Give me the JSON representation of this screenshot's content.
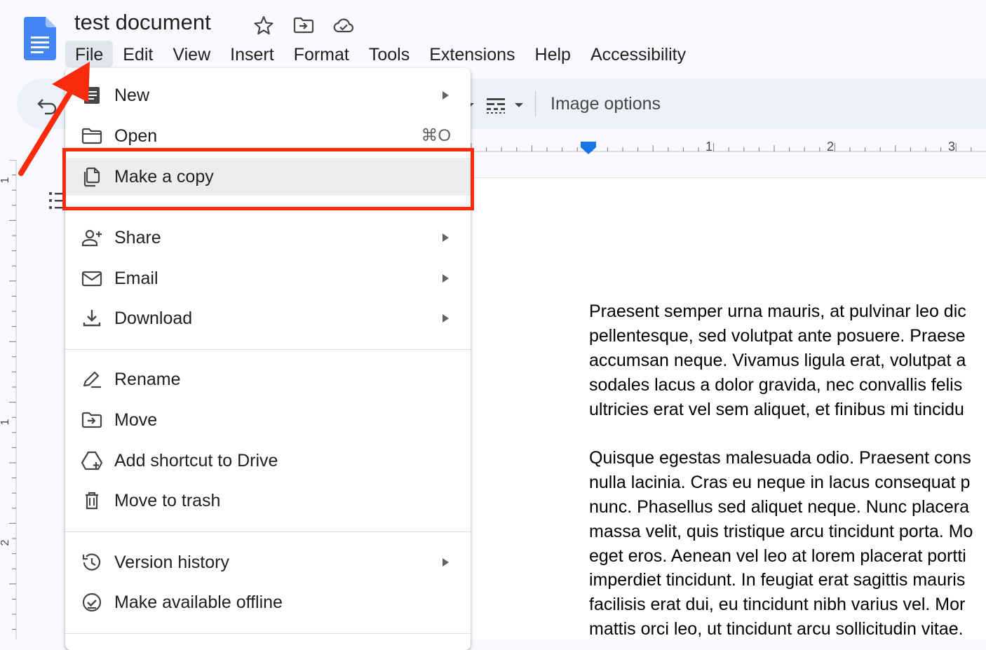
{
  "header": {
    "title": "test document",
    "icons": [
      "docs-logo-icon",
      "star-icon",
      "move-folder-icon",
      "cloud-saved-icon"
    ]
  },
  "menubar": {
    "items": [
      {
        "label": "File"
      },
      {
        "label": "Edit"
      },
      {
        "label": "View"
      },
      {
        "label": "Insert"
      },
      {
        "label": "Format"
      },
      {
        "label": "Tools"
      },
      {
        "label": "Extensions"
      },
      {
        "label": "Help"
      },
      {
        "label": "Accessibility"
      }
    ],
    "active": "File"
  },
  "toolbar": {
    "image_options_label": "Image options"
  },
  "ruler": {
    "h_labels": [
      "1",
      "2",
      "3"
    ],
    "v_labels": [
      "1",
      "1",
      "2"
    ]
  },
  "file_menu": {
    "items": {
      "new": {
        "label": "New",
        "icon": "new-doc-icon",
        "submenu": true
      },
      "open": {
        "label": "Open",
        "icon": "folder-icon",
        "shortcut": "⌘O"
      },
      "make_copy": {
        "label": "Make a copy",
        "icon": "copy-icon",
        "highlighted": true
      },
      "share": {
        "label": "Share",
        "icon": "share-person-icon",
        "submenu": true
      },
      "email": {
        "label": "Email",
        "icon": "mail-icon",
        "submenu": true
      },
      "download": {
        "label": "Download",
        "icon": "download-icon",
        "submenu": true
      },
      "rename": {
        "label": "Rename",
        "icon": "rename-icon"
      },
      "move": {
        "label": "Move",
        "icon": "move-folder-icon"
      },
      "add_shortcut": {
        "label": "Add shortcut to Drive",
        "icon": "drive-shortcut-icon"
      },
      "trash": {
        "label": "Move to trash",
        "icon": "trash-icon"
      },
      "version_history": {
        "label": "Version history",
        "icon": "history-icon",
        "submenu": true
      },
      "offline": {
        "label": "Make available offline",
        "icon": "offline-check-icon"
      }
    }
  },
  "document": {
    "paragraph1": [
      "Praesent semper urna mauris, at pulvinar leo dic",
      "pellentesque, sed volutpat ante posuere. Praese",
      "accumsan neque. Vivamus ligula erat, volutpat a",
      "sodales lacus a dolor gravida, nec convallis felis",
      "ultricies erat vel sem aliquet, et finibus mi tincidu"
    ],
    "paragraph2": [
      "Quisque egestas malesuada odio. Praesent cons",
      "nulla lacinia. Cras eu neque in lacus consequat p",
      "nunc. Phasellus sed aliquet neque. Nunc placera",
      "massa velit, quis tristique arcu tincidunt porta. Mo",
      "eget eros. Aenean vel leo at lorem placerat portti",
      "imperdiet tincidunt. In feugiat erat sagittis mauris",
      "facilisis erat dui, eu tincidunt nibh varius vel. Mor",
      "mattis orci leo, ut tincidunt arcu sollicitudin vitae."
    ]
  },
  "annotation": {
    "color": "#fa2a0c",
    "accent_blue": "#4285f4"
  }
}
